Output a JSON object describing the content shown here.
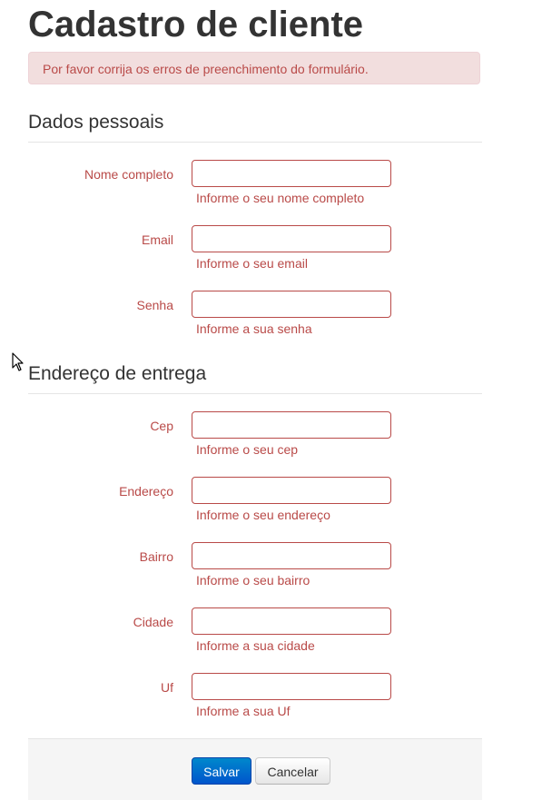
{
  "page": {
    "title": "Cadastro de cliente",
    "alert": "Por favor corrija os erros de preenchimento do formulário."
  },
  "sections": {
    "personal": {
      "legend": "Dados pessoais",
      "fields": [
        {
          "label": "Nome completo",
          "value": "",
          "help": "Informe o seu nome completo"
        },
        {
          "label": "Email",
          "value": "",
          "help": "Informe o seu email"
        },
        {
          "label": "Senha",
          "value": "",
          "help": "Informe a sua senha"
        }
      ]
    },
    "address": {
      "legend": "Endereço de entrega",
      "fields": [
        {
          "label": "Cep",
          "value": "",
          "help": "Informe o seu cep"
        },
        {
          "label": "Endereço",
          "value": "",
          "help": "Informe o seu endereço"
        },
        {
          "label": "Bairro",
          "value": "",
          "help": "Informe o seu bairro"
        },
        {
          "label": "Cidade",
          "value": "",
          "help": "Informe a sua cidade"
        },
        {
          "label": "Uf",
          "value": "",
          "help": "Informe a sua Uf"
        }
      ]
    }
  },
  "actions": {
    "save_label": "Salvar",
    "cancel_label": "Cancelar"
  },
  "colors": {
    "error": "#b94a48",
    "alert_bg": "#f2dede",
    "primary": "#0074cc"
  }
}
